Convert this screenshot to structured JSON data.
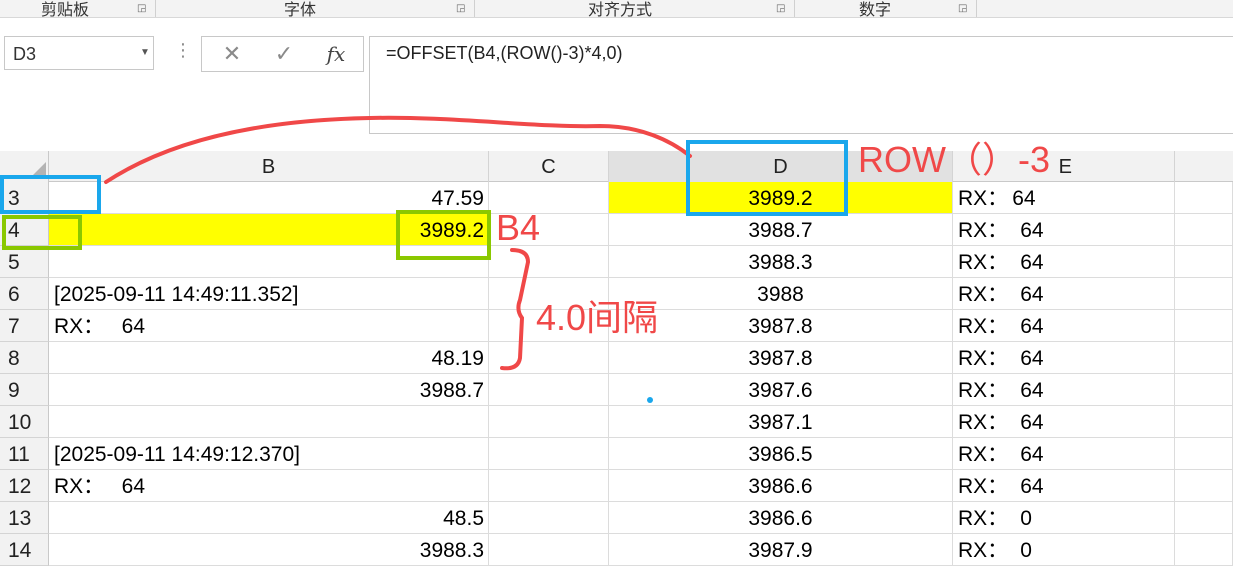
{
  "ribbon": {
    "groups": [
      "剪贴板",
      "字体",
      "对齐方式",
      "数字"
    ],
    "launcher_icon": "dialog-launcher-icon"
  },
  "formula_bar": {
    "name_box": "D3",
    "cancel_glyph": "✕",
    "enter_glyph": "✓",
    "fx_label": "fx",
    "formula": "=OFFSET(B4,(ROW()-3)*4,0)"
  },
  "columns": [
    "B",
    "C",
    "D",
    "E"
  ],
  "rows": [
    {
      "n": "3",
      "b": "47.59",
      "d": "3989.2",
      "e1": "RX：",
      "e2": "64"
    },
    {
      "n": "4",
      "b": "3989.2",
      "d": "3988.7",
      "e1": "RX：",
      "e2": "64"
    },
    {
      "n": "5",
      "b": "",
      "d": "3988.3",
      "e1": "RX：",
      "e2": "64"
    },
    {
      "n": "6",
      "b": "[2025-09-11 14:49:11.352]",
      "d": "3988",
      "e1": "RX：",
      "e2": "64"
    },
    {
      "n": "7",
      "b": "RX：   64",
      "d": "3987.8",
      "e1": "RX：",
      "e2": "64"
    },
    {
      "n": "8",
      "b": "48.19",
      "d": "3987.8",
      "e1": "RX：",
      "e2": "64"
    },
    {
      "n": "9",
      "b": "3988.7",
      "d": "3987.6",
      "e1": "RX：",
      "e2": "64"
    },
    {
      "n": "10",
      "b": "",
      "d": "3987.1",
      "e1": "RX：",
      "e2": "64"
    },
    {
      "n": "11",
      "b": "[2025-09-11 14:49:12.370]",
      "d": "3986.5",
      "e1": "RX：",
      "e2": "64"
    },
    {
      "n": "12",
      "b": "RX：   64",
      "d": "3986.6",
      "e1": "RX：",
      "e2": "64"
    },
    {
      "n": "13",
      "b": "48.5",
      "d": "3986.6",
      "e1": "RX：",
      "e2": "0"
    },
    {
      "n": "14",
      "b": "3988.3",
      "d": "3987.9",
      "e1": "RX：",
      "e2": "0"
    }
  ],
  "annotations": {
    "row_label": "ROW（）-3",
    "b4_label": "B4",
    "interval_label": "4.0间隔"
  },
  "colors": {
    "highlight": "#ffff00",
    "annotation_red": "#f04848",
    "box_blue": "#1aa7ec",
    "box_green": "#8ac800"
  }
}
